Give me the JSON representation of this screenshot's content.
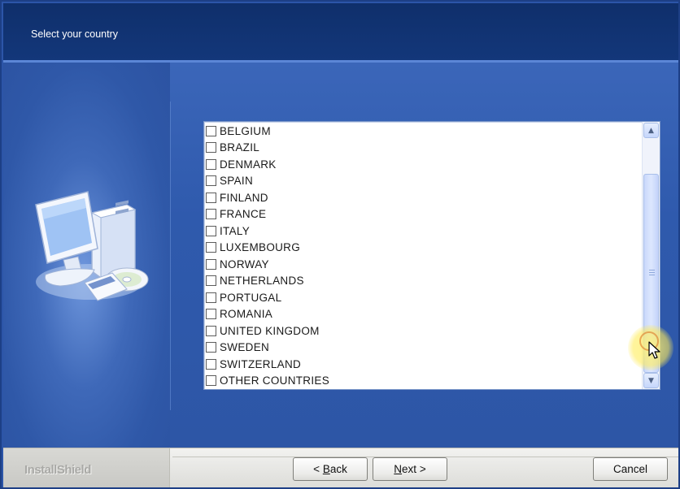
{
  "window": {
    "title": "Select your country"
  },
  "countries": [
    {
      "label": "BELGIUM",
      "checked": false
    },
    {
      "label": "BRAZIL",
      "checked": false
    },
    {
      "label": "DENMARK",
      "checked": false
    },
    {
      "label": "SPAIN",
      "checked": false
    },
    {
      "label": "FINLAND",
      "checked": false
    },
    {
      "label": "FRANCE",
      "checked": false
    },
    {
      "label": "ITALY",
      "checked": false
    },
    {
      "label": "LUXEMBOURG",
      "checked": false
    },
    {
      "label": "NORWAY",
      "checked": false
    },
    {
      "label": "NETHERLANDS",
      "checked": false
    },
    {
      "label": "PORTUGAL",
      "checked": false
    },
    {
      "label": "ROMANIA",
      "checked": false
    },
    {
      "label": "UNITED KINGDOM",
      "checked": false
    },
    {
      "label": "SWEDEN",
      "checked": false
    },
    {
      "label": "SWITZERLAND",
      "checked": false
    },
    {
      "label": "OTHER COUNTRIES",
      "checked": false
    }
  ],
  "footer": {
    "brand": "InstallShield",
    "back_arrow": "<",
    "back_mnemonic": "B",
    "back_rest": "ack",
    "next_mnemonic": "N",
    "next_rest": "ext",
    "next_arrow": ">",
    "cancel_label": "Cancel"
  },
  "icons": {
    "scroll_up": "scroll-up-arrow-icon",
    "scroll_down": "scroll-down-arrow-icon",
    "computer": "computer-setup-icon",
    "cursor": "mouse-cursor-icon"
  },
  "colors": {
    "header_bg": "#13377a",
    "body_bg": "#2f5aad",
    "footer_bg": "#e6e6e3"
  }
}
